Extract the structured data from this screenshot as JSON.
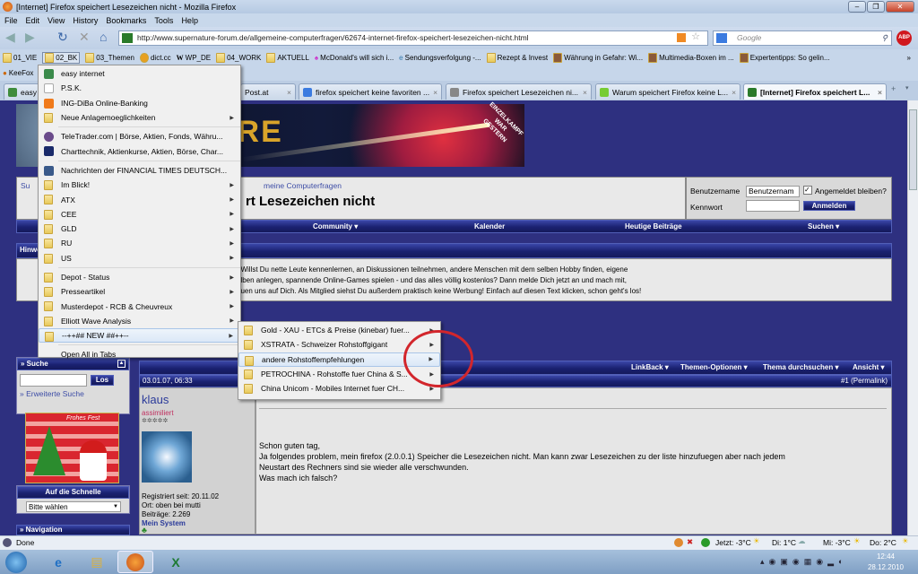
{
  "window": {
    "title": "[Internet] Firefox speichert Lesezeichen nicht - Mozilla Firefox",
    "buttons": [
      "–",
      "❐",
      "✕"
    ]
  },
  "menubar": [
    "File",
    "Edit",
    "View",
    "History",
    "Bookmarks",
    "Tools",
    "Help"
  ],
  "navbar": {
    "url": "http://www.supernature-forum.de/allgemeine-computerfragen/62674-internet-firefox-speichert-lesezeichen-nicht.html",
    "search_placeholder": "Google"
  },
  "bookmarks": [
    "01_VIE",
    "02_BK",
    "03_Themen",
    "dict.cc",
    "WP_DE",
    "04_WORK",
    "AKTUELL",
    "McDonald's will sich i...",
    "Sendungsverfolgung -...",
    "Rezept & Invest",
    "Währung in Gefahr: Wi...",
    "Multimedia-Boxen im ...",
    "Expertentipps: So gelin..."
  ],
  "bookmarks2": [
    "KeeFox"
  ],
  "tabs": [
    {
      "label": "easy i"
    },
    {
      "label": "Post.at"
    },
    {
      "label": "firefox speichert keine favoriten ..."
    },
    {
      "label": "Firefox speichert Lesezeichen ni..."
    },
    {
      "label": "Warum speichert Firefox keine L..."
    },
    {
      "label": "[Internet] Firefox speichert L..."
    }
  ],
  "dropdown": [
    {
      "label": "easy internet",
      "icon": "easy-icon"
    },
    {
      "label": "P.S.K.",
      "icon": "page-icon"
    },
    {
      "label": "ING-DiBa Online-Banking",
      "icon": "ing-icon"
    },
    {
      "label": "Neue Anlagemoeglichkeiten",
      "icon": "folder-icon",
      "sub": true
    },
    {
      "label": "TeleTrader.com | Börse, Aktien, Fonds, Währu...",
      "icon": "teletrader-icon",
      "sep": true
    },
    {
      "label": "Charttechnik, Aktienkurse, Aktien, Börse, Char...",
      "icon": "chart-icon"
    },
    {
      "label": "Nachrichten der FINANCIAL TIMES DEUTSCH...",
      "icon": "ftd-icon",
      "sep": true
    },
    {
      "label": "Im Blick!",
      "icon": "folder-icon",
      "sub": true
    },
    {
      "label": "ATX",
      "icon": "folder-icon",
      "sub": true
    },
    {
      "label": "CEE",
      "icon": "folder-icon",
      "sub": true
    },
    {
      "label": "GLD",
      "icon": "folder-icon",
      "sub": true
    },
    {
      "label": "RU",
      "icon": "folder-icon",
      "sub": true
    },
    {
      "label": "US",
      "icon": "folder-icon",
      "sub": true
    },
    {
      "label": "Depot - Status",
      "icon": "folder-icon",
      "sub": true,
      "sep": true
    },
    {
      "label": "Presseartikel",
      "icon": "folder-icon",
      "sub": true
    },
    {
      "label": "Musterdepot - RCB & Cheuvreux",
      "icon": "folder-icon",
      "sub": true
    },
    {
      "label": "Elliott Wave Analysis",
      "icon": "folder-icon",
      "sub": true
    },
    {
      "label": "--++## NEW ##++--",
      "icon": "folder-icon",
      "sub": true,
      "hl": true
    },
    {
      "label": "Open All in Tabs",
      "sep": true
    }
  ],
  "submenu": [
    {
      "label": "Gold - XAU - ETCs & Preise (kinebar) fuer..."
    },
    {
      "label": "XSTRATA - Schweizer Rohstoffgigant"
    },
    {
      "label": "andere Rohstoffempfehlungen",
      "hl": true
    },
    {
      "label": "PETROCHINA - Rohstoffe fuer China & S..."
    },
    {
      "label": "China Unicom - Mobiles Internet fuer CH..."
    }
  ],
  "forum": {
    "banner_stamp": "EINZELKAMPF WAR GESTERN",
    "breadcrumb": "meine Computerfragen",
    "breadcrumb_left": "Su",
    "title": "rt Lesezeichen nicht",
    "login": {
      "user_label": "Benutzername",
      "user_value": "Benutzernam",
      "remember": "Angemeldet bleiben?",
      "pass_label": "Kennwort",
      "submit": "Anmelden"
    },
    "nav": [
      "Community ▾",
      "Kalender",
      "Heutige Beiträge",
      "Suchen ▾"
    ],
    "hinweis_head": "Hinwe",
    "hinweis": [
      "! Willst Du nette Leute kennenlernen, an Diskussionen teilnehmen, andere Menschen mit dem selben Hobby finden, eigene",
      "alben anlegen, spannende Online-Games spielen - und das alles völlig kostenlos? Dann melde Dich jetzt an und mach mit,",
      "euen uns auf Dich. Als Mitglied siehst Du außerdem praktisch keine Werbung! Einfach auf diesen Text klicken, schon geht's los!"
    ],
    "sidebar": {
      "suche": "» Suche",
      "los": "Los",
      "erweitert": "» Erweiterte Suche",
      "xmas": "Frohes Fest",
      "schnelle": "Auf die Schnelle",
      "select": "Bitte wählen",
      "navigation": "» Navigation"
    },
    "post_tools": [
      "LinkBack ▾",
      "Themen-Optionen ▾",
      "Thema durchsuchen ▾",
      "Ansicht ▾"
    ],
    "post": {
      "date": "03.01.07, 06:33",
      "permalink": "#1 (Permalink)",
      "user": "klaus",
      "rank": "assimiliert",
      "stars": "✲✲✲✲✲",
      "registered": "Registriert seit: 20.11.02",
      "location": "Ort: oben bei mutti",
      "posts": "Beiträge: 2.269",
      "system": "Mein System",
      "body": [
        "Schon guten tag,",
        "Ja folgendes problem, mein firefox (2.0.0.1) Speicher die Lesezeichen nicht. Man kann zwar Lesezeichen zu der liste hinzufuegen aber nach jedem",
        "Neustart des Rechners sind sie wieder alle verschwunden.",
        "Was mach ich falsch?"
      ]
    }
  },
  "status": {
    "text": "Done",
    "weather": [
      "Jetzt: -3°C",
      "Di: 1°C",
      "Mi: -3°C",
      "Do: 2°C"
    ]
  },
  "taskbar": {
    "time": "12:44",
    "date": "28.12.2010"
  }
}
